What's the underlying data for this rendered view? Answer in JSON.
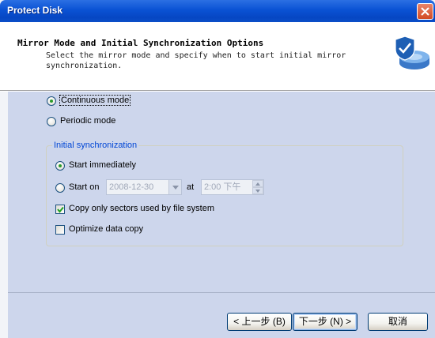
{
  "window": {
    "title": "Protect Disk"
  },
  "header": {
    "title": "Mirror Mode and Initial Synchronization Options",
    "description": "Select the mirror mode and specify when to start initial mirror synchronization."
  },
  "mirror_mode": {
    "options": [
      {
        "label": "Continuous mode",
        "selected": true
      },
      {
        "label": "Periodic mode",
        "selected": false
      }
    ]
  },
  "initial_sync": {
    "group_label": "Initial synchronization",
    "start_immediately_label": "Start immediately",
    "start_on_label": "Start on",
    "date_value": "2008-12-30",
    "at_label": "at",
    "time_value": "2:00 下午",
    "copy_used_sectors_label": "Copy only sectors used by file system",
    "copy_used_sectors_checked": true,
    "optimize_label": "Optimize data copy",
    "optimize_checked": false
  },
  "buttons": {
    "back": "< 上一步 (B)",
    "next": "下一步 (N) >",
    "cancel": "取消"
  }
}
